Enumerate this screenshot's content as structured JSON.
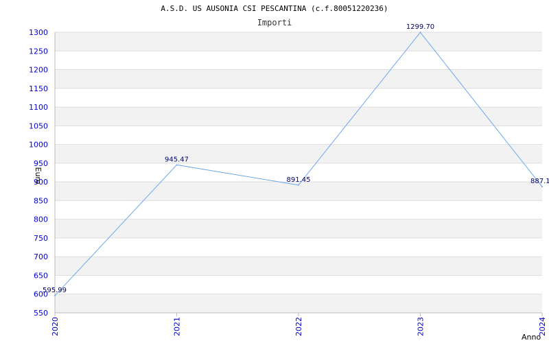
{
  "chart_data": {
    "type": "line",
    "title": "A.S.D. US AUSONIA CSI PESCANTINA (c.f.80051220236)",
    "subtitle": "Importi",
    "xlabel": "Anno",
    "ylabel": "Euro",
    "categories": [
      "2020",
      "2021",
      "2022",
      "2023",
      "2024"
    ],
    "values": [
      595.99,
      945.47,
      891.45,
      1299.7,
      887.1
    ],
    "value_labels": [
      "595.99",
      "945.47",
      "891.45",
      "1299.70",
      "887.1"
    ],
    "ylim": [
      550,
      1300
    ],
    "yticks": [
      550,
      600,
      650,
      700,
      750,
      800,
      850,
      900,
      950,
      1000,
      1050,
      1100,
      1150,
      1200,
      1250,
      1300
    ],
    "grid": true,
    "colors": {
      "line": "#6fa8ea",
      "band": "#f2f2f2",
      "grid": "#dddddd",
      "tick_text": "#0000cc",
      "data_label": "#000066"
    }
  }
}
